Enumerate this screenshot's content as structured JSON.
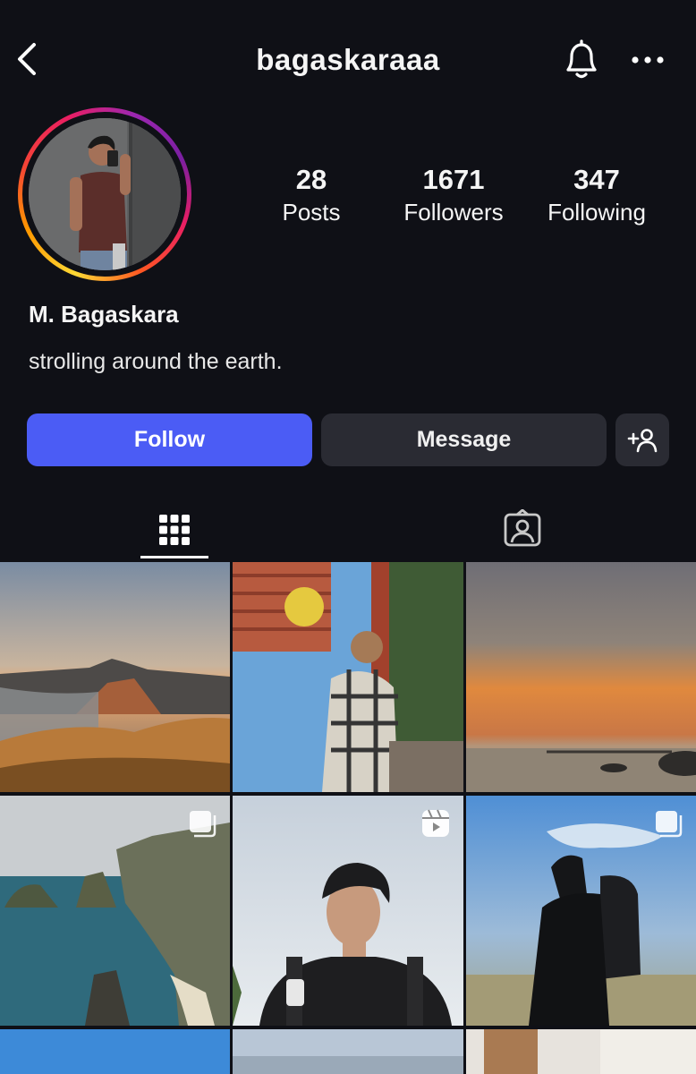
{
  "header": {
    "username": "bagaskaraaa"
  },
  "profile": {
    "full_name": "M. Bagaskara",
    "bio": "strolling around the earth.",
    "stats": {
      "posts_count": "28",
      "posts_label": "Posts",
      "followers_count": "1671",
      "followers_label": "Followers",
      "following_count": "347",
      "following_label": "Following"
    }
  },
  "actions": {
    "follow_label": "Follow",
    "message_label": "Message"
  },
  "tabs": {
    "posts_icon": "grid-icon",
    "tagged_icon": "tagged-person-icon"
  },
  "posts": [
    {
      "subject": "volcano landscape at sunrise",
      "type": "photo"
    },
    {
      "subject": "man in plaid shirt under pergola",
      "type": "photo"
    },
    {
      "subject": "sunset over sea",
      "type": "photo"
    },
    {
      "subject": "cliffs and beach coast",
      "type": "carousel"
    },
    {
      "subject": "man looking up at sky",
      "type": "reel"
    },
    {
      "subject": "hiker with backpack on hill",
      "type": "carousel"
    },
    {
      "subject": "blue sky",
      "type": "photo"
    },
    {
      "subject": "sky",
      "type": "photo"
    },
    {
      "subject": "interior room",
      "type": "photo"
    }
  ],
  "colors": {
    "background": "#0f1016",
    "follow_button": "#4b5cf5",
    "secondary_button": "#2a2b33"
  }
}
